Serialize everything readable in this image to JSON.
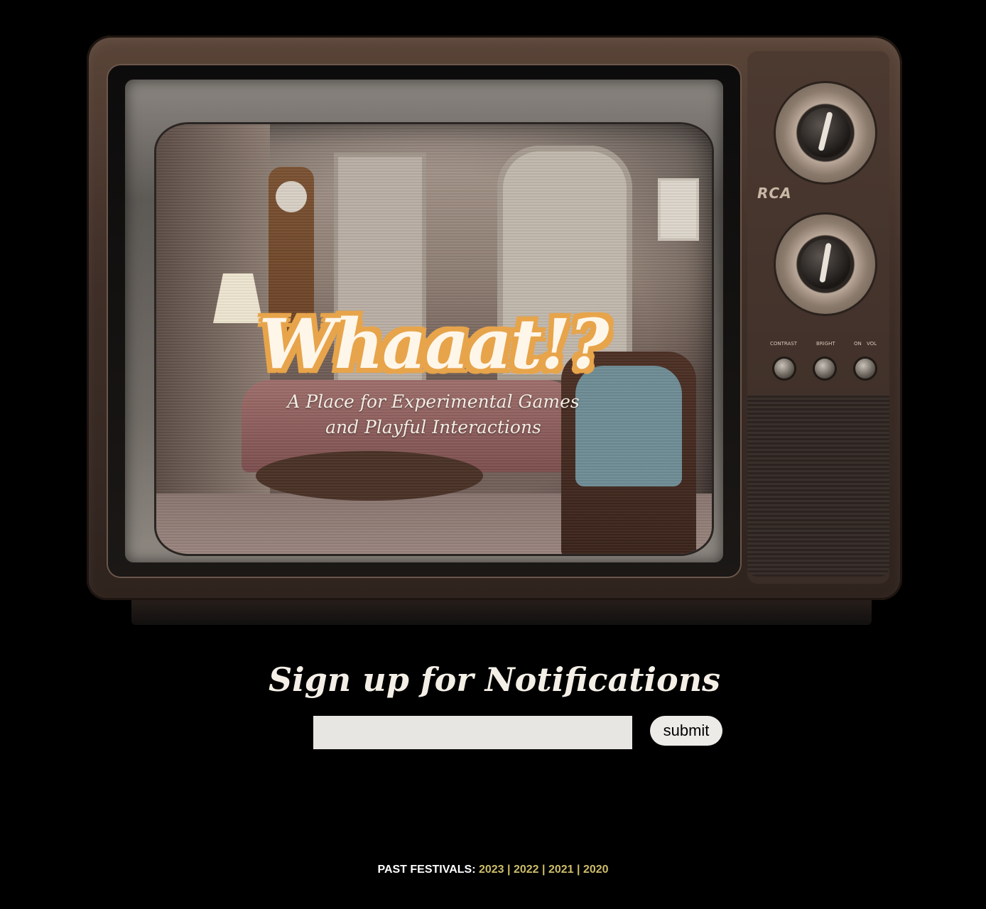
{
  "tv": {
    "brand": "RCA",
    "logo_text": "Whaaat!?",
    "tagline_line1": "A Place for Experimental Games",
    "tagline_line2": "and Playful Interactions",
    "control_labels": {
      "contrast": "CONTRAST",
      "bright": "BRIGHT",
      "on": "ON",
      "vol": "VOL"
    }
  },
  "signup": {
    "title": "Sign up for Notifications",
    "email_value": "",
    "email_placeholder": "",
    "submit_label": "submit"
  },
  "footer": {
    "label": "PAST FESTIVALS:",
    "links": [
      "2023",
      "2022",
      "2021",
      "2020"
    ],
    "separator": "|",
    "link_color": "#cdbd6a"
  }
}
